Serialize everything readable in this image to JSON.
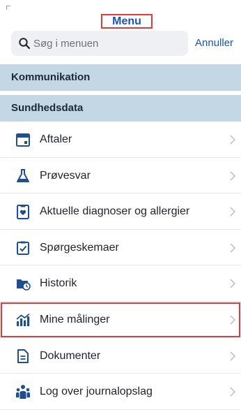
{
  "header": {
    "title": "Menu"
  },
  "search": {
    "placeholder": "Søg i menuen",
    "value": "",
    "cancel_label": "Annuller"
  },
  "sections": [
    {
      "label": "Kommunikation"
    },
    {
      "label": "Sundhedsdata"
    }
  ],
  "items": [
    {
      "label": "Aftaler",
      "icon": "calendar-icon"
    },
    {
      "label": "Prøvesvar",
      "icon": "flask-icon"
    },
    {
      "label": "Aktuelle diagnoser og allergier",
      "icon": "diagnosis-clipboard-icon"
    },
    {
      "label": "Spørgeskemaer",
      "icon": "checkbox-clipboard-icon"
    },
    {
      "label": "Historik",
      "icon": "history-folder-icon"
    },
    {
      "label": "Mine målinger",
      "icon": "measurements-chart-icon",
      "highlighted": true
    },
    {
      "label": "Dokumenter",
      "icon": "document-icon"
    },
    {
      "label": "Log over journalopslag",
      "icon": "users-log-icon"
    }
  ],
  "colors": {
    "accent": "#1a55b0",
    "icon": "#1f4e8c",
    "section_bg": "#c3d7e4",
    "highlight": "#e03a3a"
  }
}
